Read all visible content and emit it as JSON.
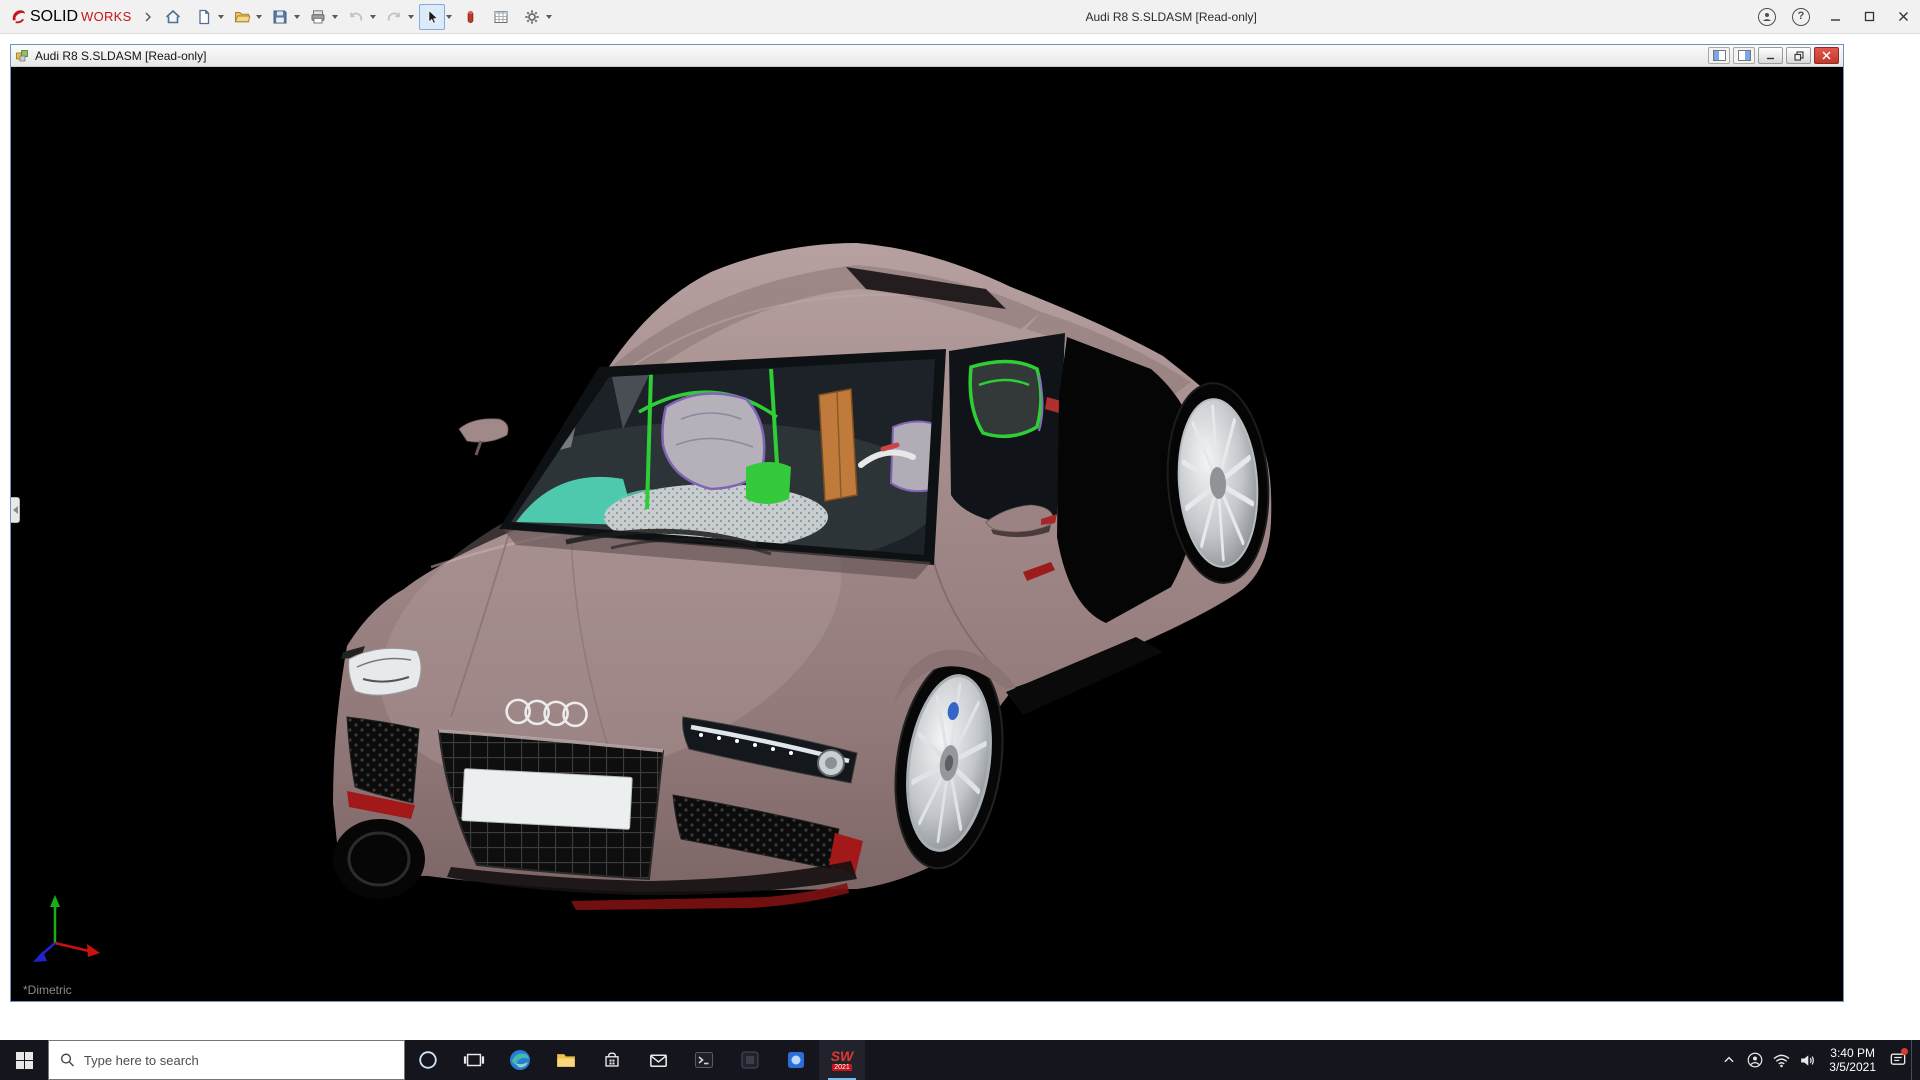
{
  "app_bar": {
    "brand_bold": "SOLID",
    "brand_light": "WORKS",
    "title": "Audi R8 S.SLDASM [Read-only]",
    "help_glyph": "?",
    "toolbar_icons": [
      "expand-arrow",
      "home",
      "new-document",
      "open",
      "save",
      "print",
      "undo",
      "redo",
      "select",
      "component",
      "design-table",
      "options-gear"
    ],
    "window_controls": [
      "user-account",
      "help",
      "minimize",
      "maximize",
      "close"
    ]
  },
  "doc_window": {
    "title": "Audi R8 S.SLDASM [Read-only]",
    "view_orientation": "*Dimetric",
    "controls": [
      "window-layout-1",
      "window-layout-2",
      "minimize",
      "restore",
      "close"
    ]
  },
  "viewport": {
    "model": "Audi R8 assembly 3D render",
    "triad_axes": [
      "x-red",
      "y-green",
      "z-blue"
    ],
    "body_color": "#a18888",
    "background": "#000000"
  },
  "taskbar": {
    "search_placeholder": "Type here to search",
    "apps": [
      "start",
      "cortana",
      "task-view",
      "edge",
      "file-explorer",
      "store",
      "mail",
      "terminal",
      "app-dark",
      "app-blue",
      "solidworks"
    ],
    "solidworks_label": "SW",
    "solidworks_badge": "2021",
    "tray_icons": [
      "hidden-icons",
      "contact",
      "network-wifi",
      "volume",
      "action-center"
    ],
    "tray_time": "3:40 PM",
    "tray_date": "3/5/2021"
  },
  "colors": {
    "accent_red": "#c2161c",
    "taskbar_bg": "#15151d",
    "active_underline": "#76b9ed"
  }
}
